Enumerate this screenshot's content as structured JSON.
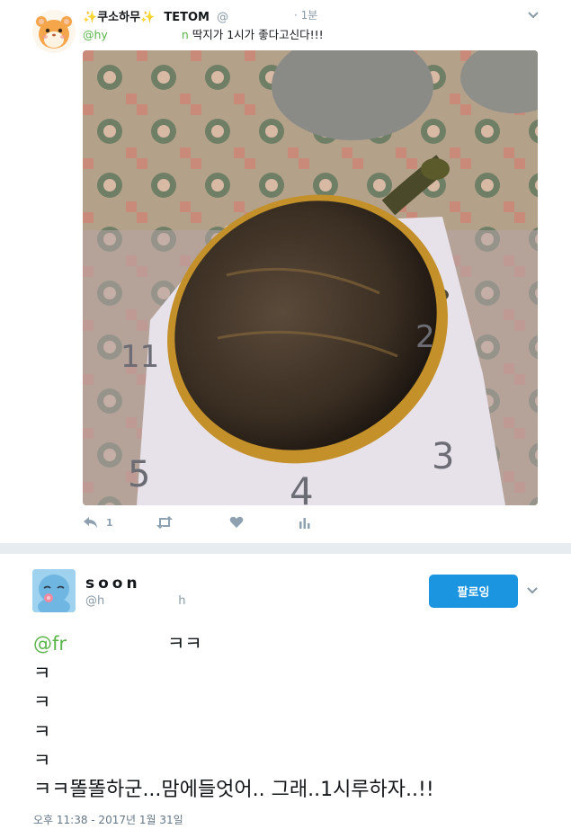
{
  "tweet1": {
    "display_name": "쿠소하무",
    "sparkle": "✨",
    "username": "TETOM",
    "handle_prefix": "@",
    "time": "· 1분",
    "reply_mention": "@hy",
    "reply_mention_tail": "n",
    "text": "딱지가 1시가 좋다고신다!!!",
    "photo_labels": [
      "11",
      "2",
      "3",
      "4",
      "5"
    ],
    "actions": {
      "reply_count": "1"
    }
  },
  "tweet2": {
    "display_name": "soon",
    "handle_start": "@h",
    "handle_end": "h",
    "follow_label": "팔로잉",
    "mention": "@fr",
    "mention_suffix": "ㅋㅋ",
    "lines": [
      "ㅋ",
      "ㅋ",
      "ㅋ",
      "ㅋ"
    ],
    "last_line": "ㅋㅋ똘똘하군...맘에들엇어.. 그래..1시루하자..!!",
    "timestamp": "오후 11:38 - 2017년 1월 31일"
  },
  "colors": {
    "accent": "#1da1f2",
    "follow_button": "#1b95e0",
    "mention_green": "#5ab54a",
    "muted": "#8899a6",
    "divider": "#e6ecf0"
  },
  "icons": [
    "hamster-avatar",
    "sparkle-icon",
    "chevron-down-icon",
    "reply-icon",
    "retweet-icon",
    "heart-icon",
    "analytics-icon",
    "squirtle-avatar"
  ]
}
